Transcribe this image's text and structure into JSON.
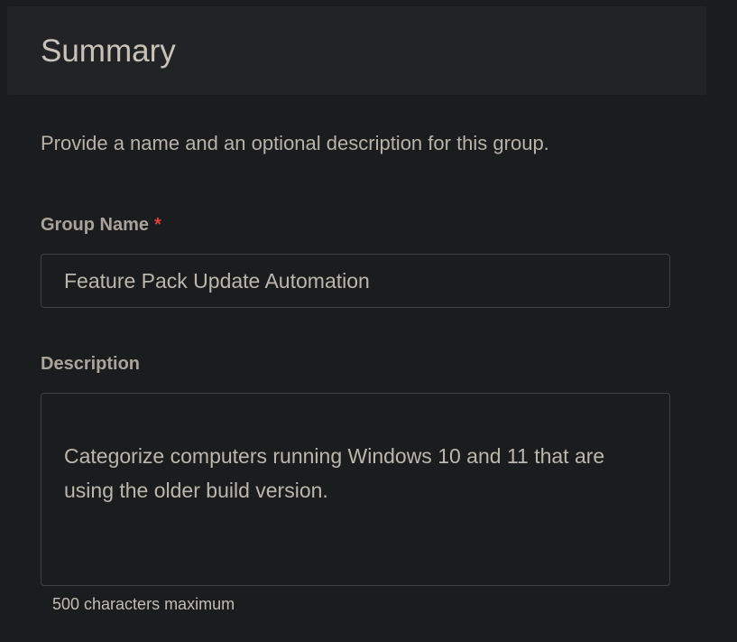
{
  "header": {
    "title": "Summary"
  },
  "intro": "Provide a name and an optional description for this group.",
  "group_name": {
    "label": "Group Name",
    "required_marker": "*",
    "value": "Feature Pack Update Automation"
  },
  "description": {
    "label": "Description",
    "value": "Categorize computers running Windows 10 and 11 that are using the older build version.",
    "hint": "500 characters maximum"
  },
  "colors": {
    "background": "#1b1c1e",
    "header_background": "#222325",
    "required": "#e0413b",
    "field_border": "#3e4043"
  }
}
